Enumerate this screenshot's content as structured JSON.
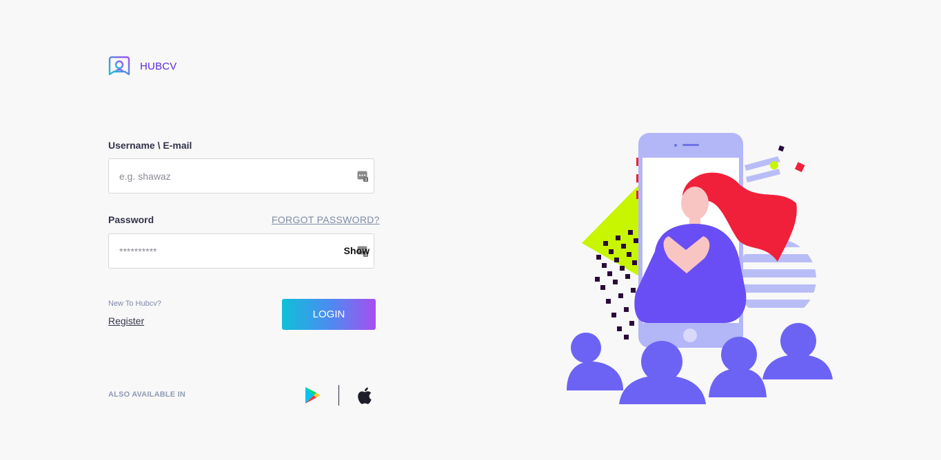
{
  "brand": {
    "name": "HUBCV",
    "logo_icon": "hubcv-logo-icon",
    "accent_color": "#5a2bd9"
  },
  "login_form": {
    "username_label": "Username \\ E-mail",
    "username_placeholder": "e.g. shawaz",
    "username_value": "",
    "password_label": "Password",
    "password_placeholder": "**********",
    "password_value": "",
    "forgot_password_label": "FORGOT PASSWORD?",
    "show_label": "Show",
    "login_label": "LOGIN"
  },
  "signup": {
    "prompt": "New To Hubcv?",
    "register_label": "Register"
  },
  "stores": {
    "label": "ALSO AVAILABLE IN",
    "icons": [
      "google-play-icon",
      "apple-icon"
    ]
  },
  "illustration": {
    "icon": "phone-presenter-illustration"
  }
}
